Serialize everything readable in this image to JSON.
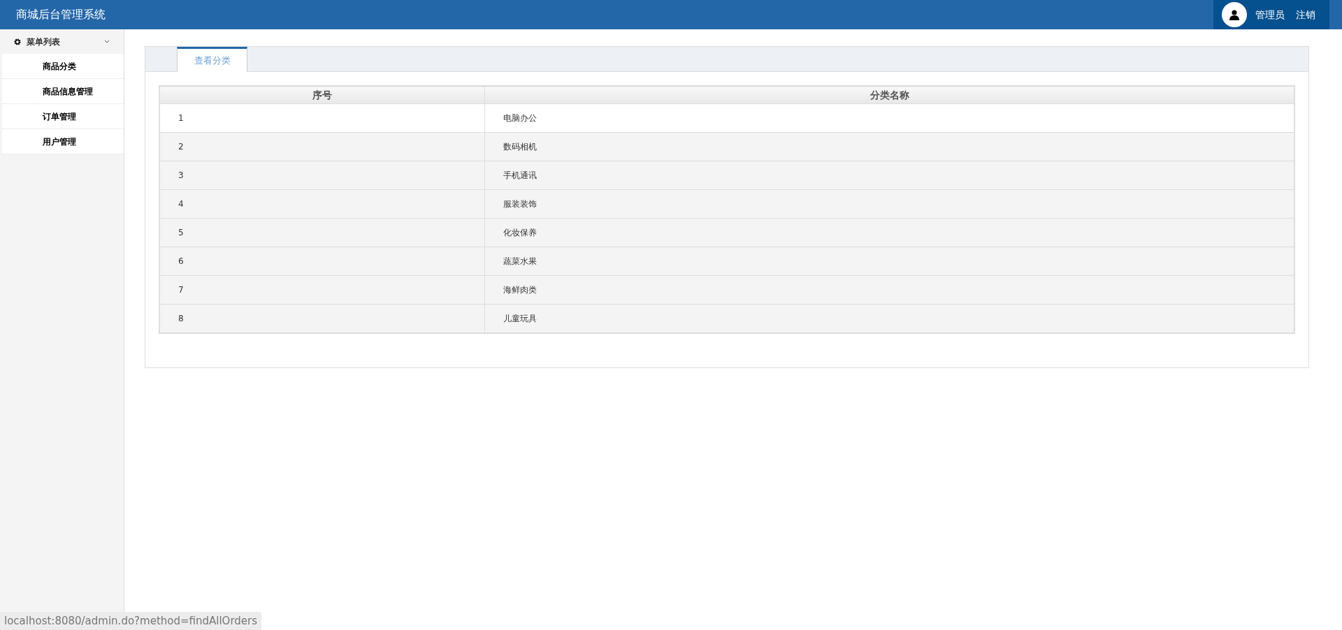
{
  "header": {
    "title": "商城后台管理系统",
    "user": "管理员",
    "logout": "注销"
  },
  "sidebar": {
    "title": "菜单列表",
    "expanded": true,
    "items": [
      {
        "label": "商品分类"
      },
      {
        "label": "商品信息管理"
      },
      {
        "label": "订单管理"
      },
      {
        "label": "用户管理"
      }
    ]
  },
  "tabs": [
    {
      "label": "查看分类",
      "selected": true
    }
  ],
  "table": {
    "columns": [
      "序号",
      "分类名称"
    ],
    "rows": [
      [
        "1",
        "电脑办公"
      ],
      [
        "2",
        "数码相机"
      ],
      [
        "3",
        "手机通讯"
      ],
      [
        "4",
        "服装装饰"
      ],
      [
        "5",
        "化妆保养"
      ],
      [
        "6",
        "蔬菜水果"
      ],
      [
        "7",
        "海鲜肉类"
      ],
      [
        "8",
        "儿童玩具"
      ]
    ]
  },
  "status_bar": "localhost:8080/admin.do?method=findAllOrders"
}
